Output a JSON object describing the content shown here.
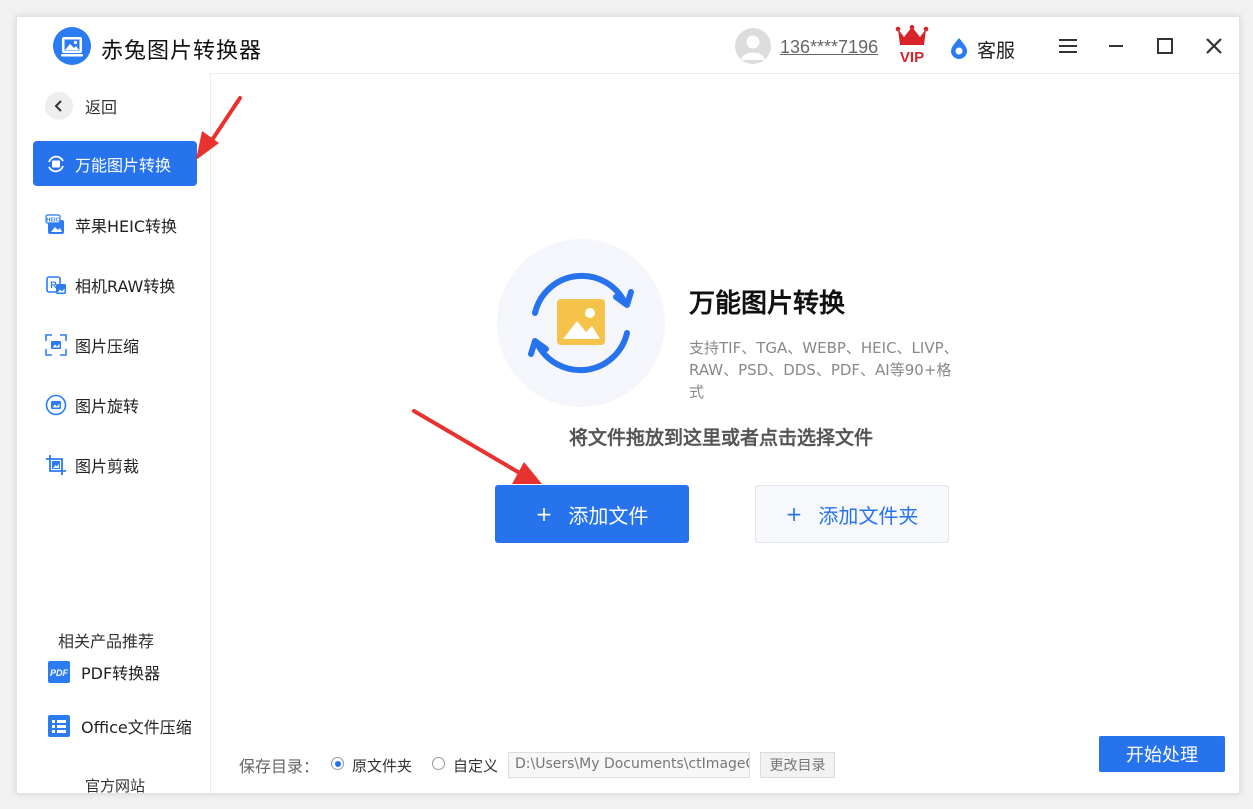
{
  "app": {
    "title": "赤兔图片转换器"
  },
  "header": {
    "phone": "136****7196",
    "vip_label": "VIP",
    "service_label": "客服"
  },
  "sidebar": {
    "back_label": "返回",
    "items": [
      {
        "label": "万能图片转换",
        "icon": "image-convert-icon",
        "active": true
      },
      {
        "label": "苹果HEIC转换",
        "icon": "heic-icon",
        "active": false
      },
      {
        "label": "相机RAW转换",
        "icon": "raw-icon",
        "active": false
      },
      {
        "label": "图片压缩",
        "icon": "compress-icon",
        "active": false
      },
      {
        "label": "图片旋转",
        "icon": "rotate-icon",
        "active": false
      },
      {
        "label": "图片剪裁",
        "icon": "crop-icon",
        "active": false
      }
    ],
    "related_title": "相关产品推荐",
    "related": [
      {
        "label": "PDF转换器",
        "icon": "pdf-icon",
        "icon_text": "PDF"
      },
      {
        "label": "Office文件压缩",
        "icon": "office-icon"
      }
    ],
    "website_label": "官方网站"
  },
  "main": {
    "feature_title": "万能图片转换",
    "feature_desc": "支持TIF、TGA、WEBP、HEIC、LIVP、RAW、PSD、DDS、PDF、AI等90+格式",
    "drop_hint": "将文件拖放到这里或者点击选择文件",
    "add_file_label": "添加文件",
    "add_folder_label": "添加文件夹",
    "plus": "+"
  },
  "footer": {
    "save_label": "保存目录：",
    "options": [
      {
        "label": "原文件夹",
        "checked": true
      },
      {
        "label": "自定义",
        "checked": false
      }
    ],
    "path_value": "D:\\Users\\My Documents\\ctImageC",
    "change_dir_label": "更改目录",
    "start_label": "开始处理"
  },
  "colors": {
    "accent": "#2773ee",
    "vip_red": "#d9232b",
    "icon_yellow": "#f5c24a"
  }
}
